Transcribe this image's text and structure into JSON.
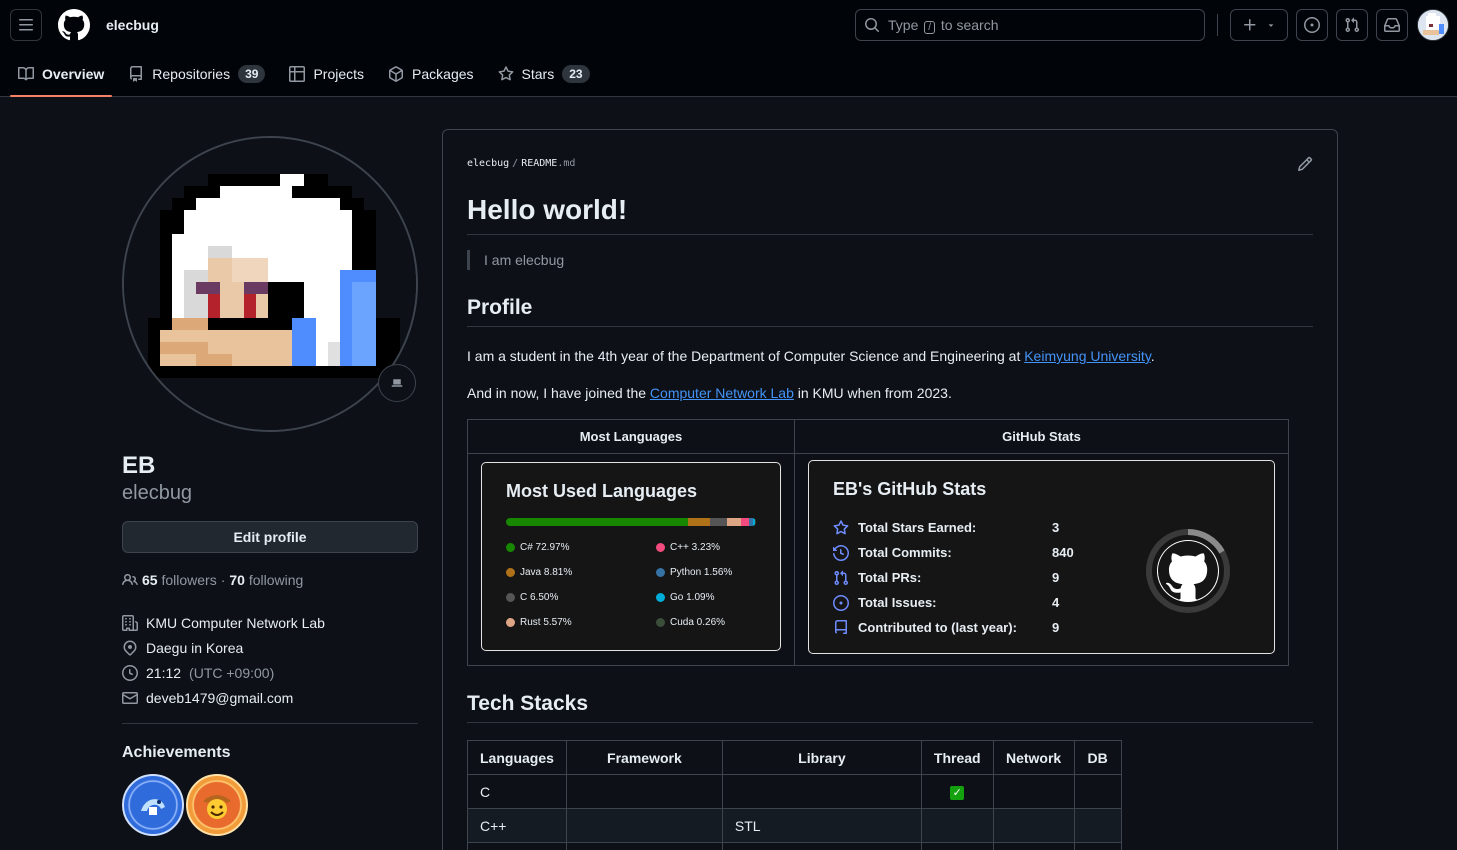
{
  "header": {
    "username": "elecbug",
    "search_prefix": "Type",
    "search_key": "/",
    "search_suffix": "to search"
  },
  "tabs": [
    {
      "label": "Overview",
      "icon": "book-icon",
      "active": true
    },
    {
      "label": "Repositories",
      "count": "39",
      "icon": "repo-icon"
    },
    {
      "label": "Projects",
      "icon": "table-icon"
    },
    {
      "label": "Packages",
      "icon": "package-icon"
    },
    {
      "label": "Stars",
      "count": "23",
      "icon": "star-icon"
    }
  ],
  "profile": {
    "name": "EB",
    "login": "elecbug",
    "edit_label": "Edit profile",
    "followers_count": "65",
    "followers_label": "followers",
    "dot": "·",
    "following_count": "70",
    "following_label": "following",
    "organization": "KMU Computer Network Lab",
    "location": "Daegu in Korea",
    "time": "21:12",
    "timezone": "(UTC +09:00)",
    "email": "deveb1479@gmail.com",
    "achievements_title": "Achievements"
  },
  "readme": {
    "owner": "elecbug",
    "path_sep": "/",
    "file_base": "README",
    "file_ext": ".md",
    "h1": "Hello world!",
    "quote": "I am elecbug",
    "profile_heading": "Profile",
    "p1_prefix": "I am a student in the 4th year of the Department of Computer Science and Engineering at ",
    "p1_link": "Keimyung University",
    "p1_suffix": ".",
    "p2_prefix": "And in now, I have joined the ",
    "p2_link": "Computer Network Lab",
    "p2_suffix": " in KMU when from 2023.",
    "col_languages": "Most Languages",
    "col_stats": "GitHub Stats",
    "tech_heading": "Tech Stacks"
  },
  "languages_card": {
    "title": "Most Used Languages",
    "items": [
      {
        "name": "C#",
        "pct": "72.97%",
        "value": 72.97,
        "color": "#178600"
      },
      {
        "name": "C++",
        "pct": "3.23%",
        "value": 3.23,
        "color": "#f34b7d"
      },
      {
        "name": "Java",
        "pct": "8.81%",
        "value": 8.81,
        "color": "#b07219"
      },
      {
        "name": "Python",
        "pct": "1.56%",
        "value": 1.56,
        "color": "#3572a5"
      },
      {
        "name": "C",
        "pct": "6.50%",
        "value": 6.5,
        "color": "#555555"
      },
      {
        "name": "Go",
        "pct": "1.09%",
        "value": 1.09,
        "color": "#00add8"
      },
      {
        "name": "Rust",
        "pct": "5.57%",
        "value": 5.57,
        "color": "#dea584"
      },
      {
        "name": "Cuda",
        "pct": "0.26%",
        "value": 0.26,
        "color": "#3a4e3a"
      }
    ]
  },
  "stats_card": {
    "title": "EB's GitHub Stats",
    "rows": [
      {
        "label": "Total Stars Earned:",
        "value": "3",
        "icon": "star-icon"
      },
      {
        "label": "Total Commits:",
        "value": "840",
        "icon": "history-icon"
      },
      {
        "label": "Total PRs:",
        "value": "9",
        "icon": "pull-request-icon"
      },
      {
        "label": "Total Issues:",
        "value": "4",
        "icon": "issue-icon"
      },
      {
        "label": "Contributed to (last year):",
        "value": "9",
        "icon": "repo-icon"
      }
    ]
  },
  "tech_table": {
    "headers": [
      "Languages",
      "Framework",
      "Library",
      "Thread",
      "Network",
      "DB"
    ],
    "rows": [
      {
        "cells": [
          "C",
          "",
          "",
          "",
          "",
          ""
        ],
        "thread_check": true
      },
      {
        "cells": [
          "C++",
          "",
          "STL",
          "",
          "",
          ""
        ],
        "thread_check": false
      }
    ]
  },
  "colors": {
    "accent_underline": "#f78166",
    "link": "#4493f8",
    "background": "#0d1117"
  }
}
